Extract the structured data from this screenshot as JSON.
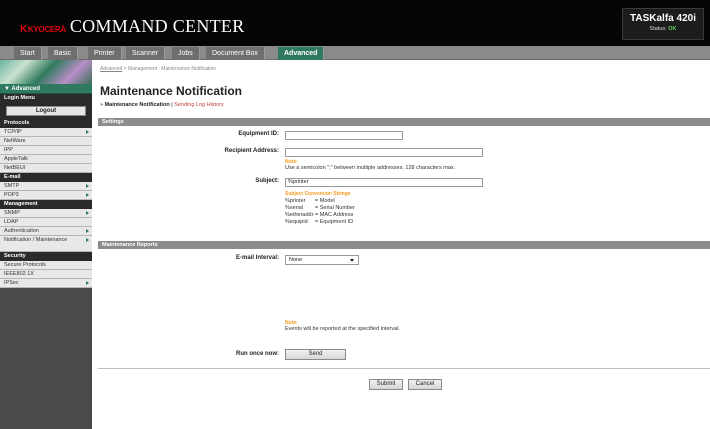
{
  "header": {
    "logo_prefix": "K",
    "logo_word": "KYOCERA",
    "app_title": "COMMAND CENTER",
    "device_name": "TASKalfa 420i",
    "status_label": "Status:",
    "status_value": "OK"
  },
  "tabs": [
    "Start",
    "Basic",
    "Printer",
    "Scanner",
    "Jobs",
    "Document Box",
    "Advanced"
  ],
  "sidebar": {
    "advanced_label": "▼ Advanced",
    "login_menu": "Login Menu",
    "logout_label": "Logout",
    "sections": [
      {
        "title": "Protocols",
        "items": [
          {
            "label": "TCP/IP",
            "arrow": true
          },
          {
            "label": "NetWare",
            "arrow": false
          },
          {
            "label": "IPP",
            "arrow": false
          },
          {
            "label": "AppleTalk",
            "arrow": false
          },
          {
            "label": "NetBEUI",
            "arrow": false
          }
        ]
      },
      {
        "title": "E-mail",
        "items": [
          {
            "label": "SMTP",
            "arrow": true
          },
          {
            "label": "POP3",
            "arrow": true
          }
        ]
      },
      {
        "title": "Management",
        "items": [
          {
            "label": "SNMP",
            "arrow": true
          },
          {
            "label": "LDAP",
            "arrow": false
          },
          {
            "label": "Authentication",
            "arrow": true
          },
          {
            "label": "Notification / Maintenance",
            "arrow": true
          }
        ]
      },
      {
        "title": "Security",
        "items": [
          {
            "label": "Secure Protocols",
            "arrow": false
          },
          {
            "label": "IEEE802.1X",
            "arrow": false
          },
          {
            "label": "IPSec",
            "arrow": true
          }
        ]
      }
    ]
  },
  "breadcrumb": {
    "link": "Advanced",
    "separator": ">",
    "rest": "Management : Maintenance Notification"
  },
  "page_title": "Maintenance Notification",
  "subnav": {
    "current": "Maintenance Notification",
    "separator": "|",
    "link": "Sending Log History"
  },
  "settings": {
    "section_title": "Settings",
    "equipment_id_label": "Equipment ID:",
    "equipment_id_value": "",
    "recipient_label": "Recipient Address:",
    "recipient_value": "",
    "note_label": "Note:",
    "note_text": "Use a semicolon \";\" between multiple addresses. 128 characters max.",
    "subject_label": "Subject:",
    "subject_value": "%printer",
    "conversion_title": "Subject Conversion Strings",
    "conversions": [
      {
        "key": "%printer",
        "value": "= Model"
      },
      {
        "key": "%serial",
        "value": "= Serial Number"
      },
      {
        "key": "%etheraddr",
        "value": "= MAC Address"
      },
      {
        "key": "%equipid",
        "value": "= Equipment ID"
      }
    ]
  },
  "reports": {
    "section_title": "Maintenance Reports",
    "interval_label": "E-mail Interval:",
    "interval_value": "None",
    "note_label": "Note:",
    "note_text": "Events will be reported at the specified interval.",
    "run_label": "Run once now:",
    "send_label": "Send"
  },
  "footer": {
    "submit_label": "Submit",
    "cancel_label": "Cancel"
  },
  "colors": {
    "accent": "#2f7a5e",
    "note": "#f39a1e",
    "link": "#c23d3d",
    "header": "#050505"
  }
}
